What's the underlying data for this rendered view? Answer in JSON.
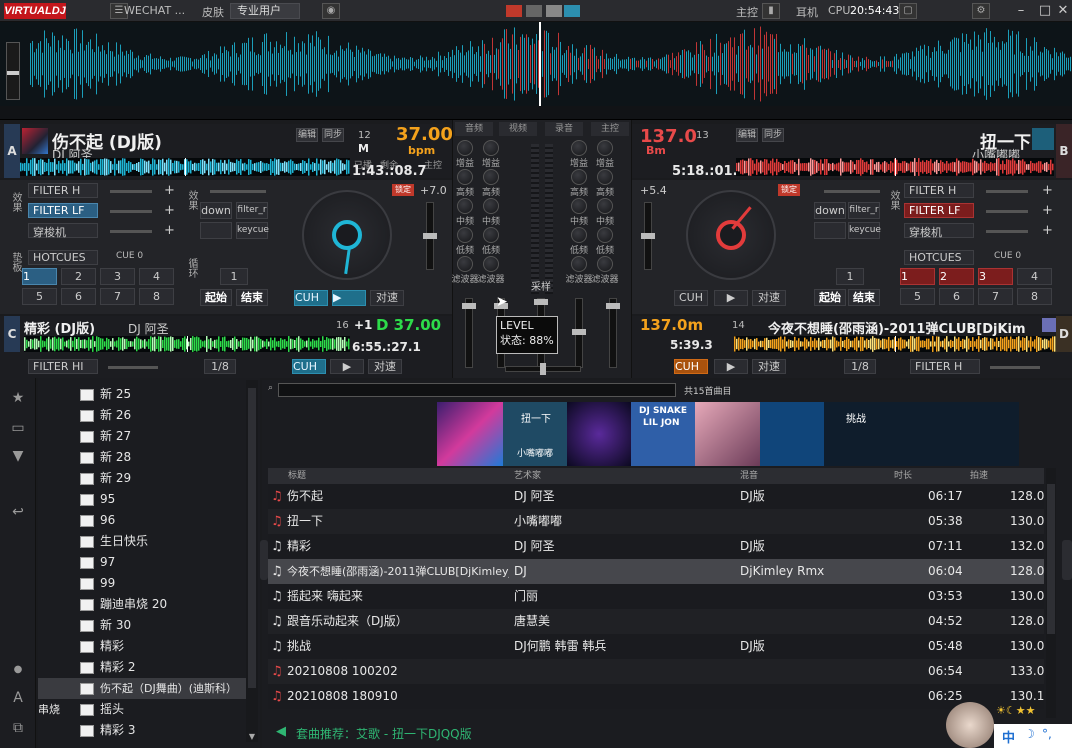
{
  "titlebar": {
    "logo": "VIRTUALDJ",
    "account": "WECHAT ...",
    "skin_label": "皮肤",
    "skin_value": "专业用户",
    "cpu_label": "CPU",
    "clock": "20:54:43",
    "master_label": "主控",
    "monitor_label": "耳机"
  },
  "deckA": {
    "letter": "A",
    "title": "伤不起 (DJ版)",
    "artist": "DJ 阿圣",
    "key": "12",
    "key_hint": "M",
    "bpm": "37.00",
    "bpm_unit": "bpm",
    "elapsed_label": "已播",
    "remain_label": "剩余",
    "time": "1:43.:08.7",
    "edit_btn": "编辑",
    "sync_btn": "同步",
    "master_btn": "主控",
    "pitch_value": "+7.0",
    "filters": [
      "FILTER H",
      "FILTER LF",
      "穿梭机"
    ],
    "fx_slots": [
      "down",
      "filter_r",
      "keycue"
    ],
    "hotcue_label": "HOTCUES",
    "cue_label": "CUE 0",
    "pads": [
      "1",
      "2",
      "3",
      "4",
      "5",
      "6",
      "7",
      "8"
    ],
    "loop_value": "1",
    "loop_in": "起始",
    "loop_out": "结束",
    "cue_btn": "CUH",
    "play_btn": "▶",
    "sync_main": "对速",
    "side_label_fx": "效果",
    "side_label_pad": "垫板",
    "side_label_loop": "循环"
  },
  "deckB": {
    "letter": "B",
    "title": "扭一下",
    "artist": "小嘴嘟嘟",
    "key": "13",
    "bpm": "137.0",
    "bpm_unit": "Bm",
    "time": "5:18.:01.9",
    "pitch_value": "+5.4",
    "filters": [
      "FILTER H",
      "FILTER LF",
      "穿梭机"
    ],
    "fx_slots": [
      "down",
      "filter_r",
      "keycue"
    ],
    "hotcue_label": "HOTCUES",
    "cue_label": "CUE 0",
    "pads": [
      "1",
      "2",
      "3",
      "4",
      "5",
      "6",
      "7",
      "8"
    ],
    "loop_value": "1",
    "loop_in": "起始",
    "loop_out": "结束",
    "cue_btn": "CUH",
    "play_btn": "▶",
    "sync_main": "对速"
  },
  "deckC": {
    "letter": "C",
    "title": "精彩 (DJ版)",
    "artist": "DJ 阿圣",
    "key": "16",
    "pitch": "+1",
    "bpm": "D 37.00",
    "time": "6:55.:27.1",
    "filter": "FILTER HI",
    "loop_value": "1/8",
    "cue_btn": "CUH",
    "play_btn": "▶",
    "sync_main": "对速"
  },
  "deckD": {
    "letter": "D",
    "title": "今夜不想睡(邵雨涵)-2011弹CLUB[DjKim",
    "key": "14",
    "bpm": "137.0m",
    "time": "5:39.3",
    "filter": "FILTER H",
    "loop_value": "1/8",
    "cue_btn": "CUH",
    "play_btn": "▶",
    "sync_main": "对速"
  },
  "mixer": {
    "tabs": [
      "音频",
      "视频",
      "录音",
      "主控"
    ],
    "eq_labels": [
      "增益",
      "高频",
      "中频",
      "低频",
      "滤波器"
    ],
    "crossfader_label": "采样"
  },
  "tooltip": {
    "title": "LEVEL",
    "status": "状态: 88%"
  },
  "browser": {
    "folders": [
      "新 25",
      "新 26",
      "新 27",
      "新 28",
      "新 29",
      "95",
      "96",
      "生日快乐",
      "97",
      "99",
      "蹦迪串烧 20",
      "新 30",
      "精彩",
      "精彩 2",
      "伤不起（DJ舞曲）(迪斯科）串烧",
      "摇头",
      "精彩 3"
    ],
    "selected_folder_index": 14,
    "count_text": "共15首曲目",
    "columns": [
      "标题",
      "艺术家",
      "混音",
      "时长",
      "拍速"
    ],
    "tracks": [
      {
        "title": "伤不起",
        "artist": "DJ 阿圣",
        "remix": "DJ版",
        "time": "06:17",
        "bpm": "128.0",
        "color": "red"
      },
      {
        "title": "扭一下",
        "artist": "小嘴嘟嘟",
        "remix": "",
        "time": "05:38",
        "bpm": "130.0",
        "color": "red"
      },
      {
        "title": "精彩",
        "artist": "DJ 阿圣",
        "remix": "DJ版",
        "time": "07:11",
        "bpm": "132.0",
        "color": "white"
      },
      {
        "title": "今夜不想睡(邵雨涵)-2011弹CLUB[DjKimley_Rmx]",
        "artist": "DJ",
        "remix": "DjKimley Rmx",
        "time": "06:04",
        "bpm": "128.0",
        "color": "white"
      },
      {
        "title": "摇起来 嗨起来",
        "artist": "门丽",
        "remix": "",
        "time": "03:53",
        "bpm": "130.0",
        "color": "white"
      },
      {
        "title": "跟音乐动起来（DJ版）",
        "artist": "唐慧美",
        "remix": "",
        "time": "04:52",
        "bpm": "128.0",
        "color": "white"
      },
      {
        "title": "挑战",
        "artist": "DJ何鹏 韩雷 韩兵",
        "remix": "DJ版",
        "time": "05:48",
        "bpm": "130.0",
        "color": "white"
      },
      {
        "title": "20210808 100202",
        "artist": "",
        "remix": "",
        "time": "06:54",
        "bpm": "133.0",
        "color": "red"
      },
      {
        "title": "20210808 180910",
        "artist": "",
        "remix": "",
        "time": "06:25",
        "bpm": "130.1",
        "color": "red"
      }
    ],
    "selected_track_index": 3,
    "art_labels": [
      "扭一下",
      "小嘴嘟嘟",
      "DJ SNAKE",
      "LIL JON",
      "挑战"
    ],
    "recommend": "套曲推荐：艾歌 - 扭一下DJQQ版",
    "ime": "中"
  },
  "colors": {
    "accent_orange": "#f4a21c",
    "accent_red": "#e84a4a",
    "accent_blue": "#2c8fb0",
    "wave_cyan": "#1fb6d6",
    "wave_red": "#e23b3b",
    "wave_green": "#2ddc4a"
  }
}
